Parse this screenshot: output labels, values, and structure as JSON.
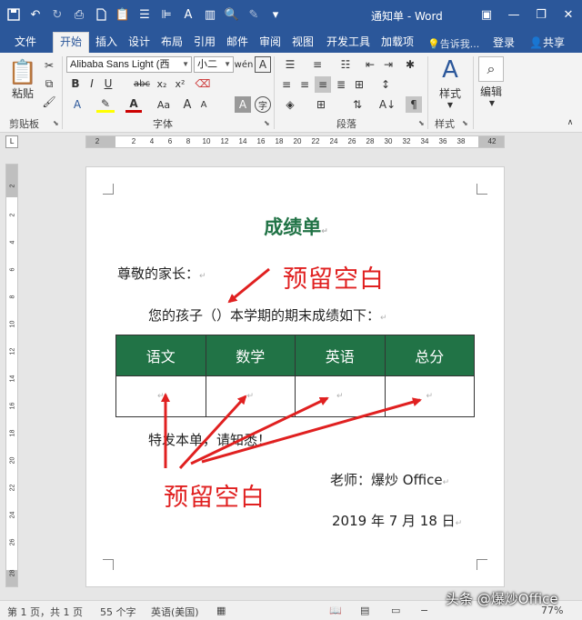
{
  "titlebar": {
    "doc_title": "通知单 - Word"
  },
  "tabs": [
    {
      "label": "文件"
    },
    {
      "label": "开始"
    },
    {
      "label": "插入"
    },
    {
      "label": "设计"
    },
    {
      "label": "布局"
    },
    {
      "label": "引用"
    },
    {
      "label": "邮件"
    },
    {
      "label": "审阅"
    },
    {
      "label": "视图"
    },
    {
      "label": "开发工具"
    },
    {
      "label": "加载项"
    }
  ],
  "tell_me": "告诉我...",
  "login": "登录",
  "share": "共享",
  "ribbon": {
    "clipboard": {
      "paste": "粘贴",
      "group": "剪贴板"
    },
    "font": {
      "family": "Alibaba Sans Light (西",
      "size": "小二",
      "group": "字体"
    },
    "paragraph": {
      "group": "段落"
    },
    "styles": {
      "label": "样式",
      "group": "样式"
    },
    "editing": {
      "label": "编辑"
    }
  },
  "ruler": {
    "ticks": [
      "2",
      "2",
      "4",
      "6",
      "8",
      "10",
      "12",
      "14",
      "16",
      "18",
      "20",
      "22",
      "24",
      "26",
      "28",
      "30",
      "32",
      "34",
      "36",
      "38",
      "42"
    ],
    "vticks": [
      "2",
      "2",
      "4",
      "6",
      "8",
      "10",
      "12",
      "14",
      "16",
      "18",
      "20",
      "22",
      "24",
      "26",
      "28"
    ]
  },
  "document": {
    "heading": "成绩单",
    "greeting": "尊敬的家长：",
    "intro": "您的孩子（）本学期的期末成绩如下：",
    "table_headers": [
      "语文",
      "数学",
      "英语",
      "总分"
    ],
    "notice": "特发本单，请知悉！",
    "teacher": "老师：爆炒 Office",
    "date": "2019 年 7 月 18 日",
    "para_mark": "↵"
  },
  "annotations": {
    "top": "预留空白",
    "bottom": "预留空白",
    "color": "#e02020"
  },
  "statusbar": {
    "page": "第 1 页，共 1 页",
    "words": "55 个字",
    "lang": "英语(美国)",
    "zoom": "77%"
  },
  "watermark": "头条 @爆炒Office",
  "colors": {
    "titlebar": "#2b579a",
    "heading": "#217346",
    "table_header": "#217346"
  }
}
